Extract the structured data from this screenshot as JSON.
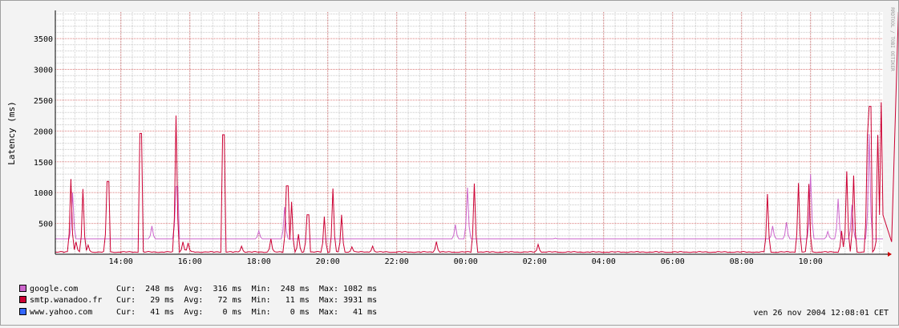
{
  "chart_data": {
    "type": "line",
    "ylabel": "Latency (ms)",
    "watermark": "RRDTOOL / TOBI OETIKER",
    "ylim": [
      0,
      3931
    ],
    "y_ticks": [
      500,
      1000,
      1500,
      2000,
      2500,
      3000,
      3500
    ],
    "x_tick_labels": [
      "14:00",
      "16:00",
      "18:00",
      "20:00",
      "22:00",
      "00:00",
      "02:00",
      "04:00",
      "06:00",
      "08:00",
      "10:00"
    ],
    "x_start_hour": 12.1,
    "x_end_hour": 36.1,
    "grid": true,
    "series": [
      {
        "name": "google.com",
        "color": "#cc66cc",
        "baseline": 248,
        "spikes": [
          [
            12.6,
            1000
          ],
          [
            14.9,
            460
          ],
          [
            15.62,
            1100
          ],
          [
            18.0,
            380
          ],
          [
            18.75,
            760
          ],
          [
            23.7,
            480
          ],
          [
            24.05,
            1080
          ],
          [
            25.95,
            250
          ],
          [
            26.6,
            260
          ],
          [
            32.9,
            460
          ],
          [
            33.3,
            520
          ],
          [
            34.0,
            1300
          ],
          [
            34.5,
            370
          ],
          [
            34.8,
            900
          ],
          [
            35.2,
            800
          ],
          [
            35.7,
            1950
          ]
        ]
      },
      {
        "name": "smtp.wanadoo.fr",
        "color": "#cc0033",
        "baseline": 30,
        "spikes": [
          [
            12.55,
            1220
          ],
          [
            12.7,
            200
          ],
          [
            12.9,
            1060
          ],
          [
            13.05,
            150
          ],
          [
            13.62,
            1180
          ],
          [
            14.58,
            1960
          ],
          [
            15.6,
            2250
          ],
          [
            15.8,
            200
          ],
          [
            15.95,
            180
          ],
          [
            16.98,
            1940
          ],
          [
            17.5,
            130
          ],
          [
            18.35,
            250
          ],
          [
            18.82,
            1110
          ],
          [
            18.95,
            850
          ],
          [
            19.15,
            320
          ],
          [
            19.42,
            640
          ],
          [
            19.9,
            610
          ],
          [
            20.15,
            1060
          ],
          [
            20.4,
            640
          ],
          [
            20.7,
            120
          ],
          [
            21.3,
            130
          ],
          [
            23.15,
            200
          ],
          [
            24.25,
            1140
          ],
          [
            26.1,
            160
          ],
          [
            32.75,
            970
          ],
          [
            33.65,
            1150
          ],
          [
            33.95,
            1140
          ],
          [
            34.9,
            380
          ],
          [
            35.05,
            1340
          ],
          [
            35.25,
            1270
          ],
          [
            35.65,
            1940
          ],
          [
            35.72,
            2400
          ],
          [
            35.9,
            210
          ],
          [
            35.95,
            1930
          ],
          [
            36.05,
            2460
          ],
          [
            36.35,
            200
          ],
          [
            36.55,
            3931
          ]
        ]
      },
      {
        "name": "www.yahoo.com",
        "color": "#3366ff",
        "baseline": 0,
        "spikes": []
      }
    ]
  },
  "legend": [
    {
      "name": "google.com",
      "color": "#cc66cc",
      "stats": "Cur:  248 ms  Avg:  316 ms  Min:  248 ms  Max: 1082 ms"
    },
    {
      "name": "smtp.wanadoo.fr",
      "color": "#cc0033",
      "stats": "Cur:   29 ms  Avg:   72 ms  Min:   11 ms  Max: 3931 ms"
    },
    {
      "name": "www.yahoo.com",
      "color": "#3366ff",
      "stats": "Cur:   41 ms  Avg:    0 ms  Min:    0 ms  Max:   41 ms"
    }
  ],
  "timestamp": "ven 26 nov 2004 12:08:01 CET"
}
